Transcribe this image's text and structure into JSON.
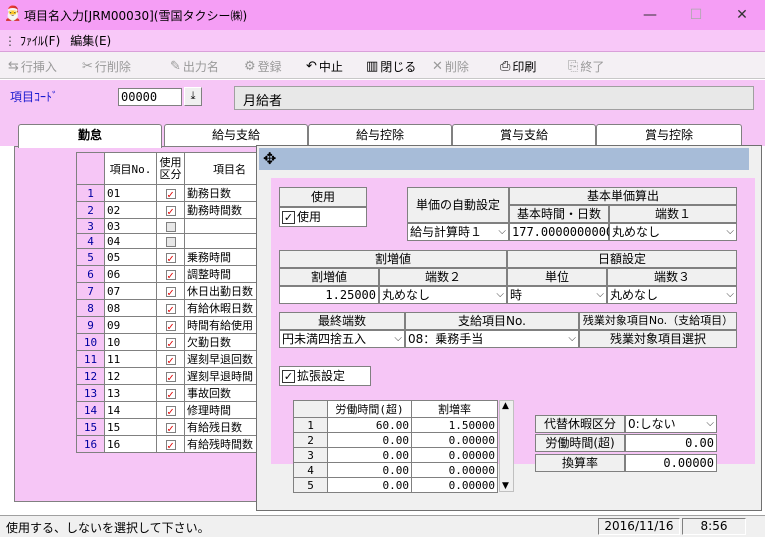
{
  "window": {
    "title": "項目名入力[JRM00030](雪国タクシー㈱)",
    "minimize_glyph": "—",
    "maximize_glyph": "☐",
    "close_glyph": "✕"
  },
  "menu": {
    "items": [
      "ﾌｧｲﾙ(F)",
      "編集(E)"
    ]
  },
  "toolbar": {
    "insert_row": "行挿入",
    "delete_row": "行削除",
    "output_name": "出力名",
    "register": "登録",
    "cancel": "中止",
    "close": "閉じる",
    "delete": "削除",
    "print": "印刷",
    "exit": "終了"
  },
  "code": {
    "label": "項目ｺｰﾄﾞ",
    "value": "00000",
    "name": "月給者"
  },
  "tabs": [
    "勤怠",
    "給与支給",
    "給与控除",
    "賞与支給",
    "賞与控除"
  ],
  "grid": {
    "col_no": "項目No.",
    "col_use": "使用区分",
    "col_name": "項目名",
    "rows": [
      {
        "n": "1",
        "code": "01",
        "use": true,
        "name": "勤務日数"
      },
      {
        "n": "2",
        "code": "02",
        "use": true,
        "name": "勤務時間数"
      },
      {
        "n": "3",
        "code": "03",
        "use": false,
        "name": ""
      },
      {
        "n": "4",
        "code": "04",
        "use": false,
        "name": ""
      },
      {
        "n": "5",
        "code": "05",
        "use": true,
        "name": "乗務時間"
      },
      {
        "n": "6",
        "code": "06",
        "use": true,
        "name": "調整時間"
      },
      {
        "n": "7",
        "code": "07",
        "use": true,
        "name": "休日出勤日数"
      },
      {
        "n": "8",
        "code": "08",
        "use": true,
        "name": "有給休暇日数"
      },
      {
        "n": "9",
        "code": "09",
        "use": true,
        "name": "時間有給使用"
      },
      {
        "n": "10",
        "code": "10",
        "use": true,
        "name": "欠勤日数"
      },
      {
        "n": "11",
        "code": "11",
        "use": true,
        "name": "遅刻早退回数"
      },
      {
        "n": "12",
        "code": "12",
        "use": true,
        "name": "遅刻早退時間"
      },
      {
        "n": "13",
        "code": "13",
        "use": true,
        "name": "事故回数"
      },
      {
        "n": "14",
        "code": "14",
        "use": true,
        "name": "修理時間"
      },
      {
        "n": "15",
        "code": "15",
        "use": true,
        "name": "有給残日数"
      },
      {
        "n": "16",
        "code": "16",
        "use": true,
        "name": "有給残時間数"
      }
    ]
  },
  "dialog": {
    "move_glyph": "✥",
    "use_header": "使用",
    "use_check": "使用",
    "auto_price_label": "単価の自動設定",
    "auto_price_value": "給与計算時１",
    "base_calc_header": "基本単価算出",
    "base_hours_label": "基本時間・日数",
    "base_hours_value": "177.0000000000",
    "rounding1_label": "端数１",
    "rounding1_value": "丸めなし",
    "premium_header": "割増値",
    "premium_label": "割増値",
    "premium_value": "1.25000",
    "rounding2_label": "端数２",
    "rounding2_value": "丸めなし",
    "daily_header": "日額設定",
    "unit_label": "単位",
    "unit_value": "時",
    "rounding3_label": "端数３",
    "rounding3_value": "丸めなし",
    "final_rounding_label": "最終端数",
    "final_rounding_value": "円未満四捨五入",
    "pay_item_label": "支給項目No.",
    "pay_item_value": "08：乗務手当",
    "overtime_target_label": "残業対象項目No.（支給項目）",
    "overtime_select_button": "残業対象項目選択",
    "extended_label": "拡張設定",
    "ext_grid": {
      "col_hours": "労働時間(超)",
      "col_rate": "割増率",
      "rows": [
        {
          "n": "1",
          "hours": "60.00",
          "rate": "1.50000"
        },
        {
          "n": "2",
          "hours": "0.00",
          "rate": "0.00000"
        },
        {
          "n": "3",
          "hours": "0.00",
          "rate": "0.00000"
        },
        {
          "n": "4",
          "hours": "0.00",
          "rate": "0.00000"
        },
        {
          "n": "5",
          "hours": "0.00",
          "rate": "0.00000"
        }
      ]
    },
    "substitute_label": "代替休暇区分",
    "substitute_value": "0:しない",
    "work_hours_label": "労働時間(超)",
    "work_hours_value": "0.00",
    "conversion_label": "換算率",
    "conversion_value": "0.00000"
  },
  "status": {
    "message": "使用する、しないを選択して下さい。",
    "date": "2016/11/16",
    "time": "8:56"
  }
}
